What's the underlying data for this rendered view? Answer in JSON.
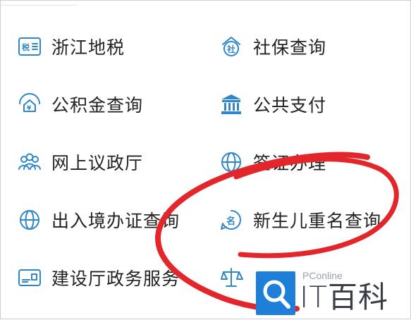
{
  "services": [
    {
      "label": "浙江地税",
      "icon": "tax-card-icon"
    },
    {
      "label": "社保查询",
      "icon": "social-security-icon"
    },
    {
      "label": "公积金查询",
      "icon": "housing-fund-icon"
    },
    {
      "label": "公共支付",
      "icon": "bank-building-icon"
    },
    {
      "label": "网上议政厅",
      "icon": "people-group-icon"
    },
    {
      "label": "签证办理",
      "icon": "globe-icon"
    },
    {
      "label": "出入境办证查询",
      "icon": "globe-icon"
    },
    {
      "label": "新生儿重名查询",
      "icon": "name-tag-icon"
    },
    {
      "label": "建设厅政务服务",
      "icon": "id-card-icon"
    },
    {
      "label": "",
      "icon": "scales-icon"
    }
  ],
  "annotation": {
    "color": "#e2262b",
    "shape": "hand-drawn-circle"
  },
  "watermark": {
    "brand_small": "PConline",
    "brand_large": "IT百科",
    "accent": "#1e7fd9"
  }
}
